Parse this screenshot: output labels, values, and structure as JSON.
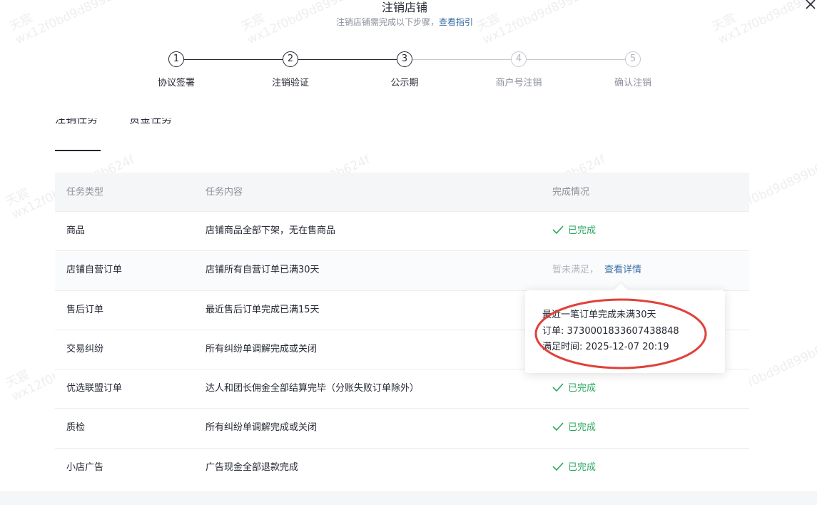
{
  "header": {
    "title": "注销店铺",
    "subtitle": "注销店铺需完成以下步骤，",
    "guide_link": "查看指引"
  },
  "steps": [
    {
      "num": "1",
      "label": "协议签署",
      "state": "done"
    },
    {
      "num": "2",
      "label": "注销验证",
      "state": "done"
    },
    {
      "num": "3",
      "label": "公示期",
      "state": "current"
    },
    {
      "num": "4",
      "label": "商户号注销",
      "state": "pending"
    },
    {
      "num": "5",
      "label": "确认注销",
      "state": "pending"
    }
  ],
  "tabs": [
    {
      "label": "注销任务",
      "active": true
    },
    {
      "label": "资金任务",
      "active": false
    }
  ],
  "table": {
    "headers": [
      "任务类型",
      "任务内容",
      "完成情况"
    ],
    "rows": [
      {
        "type": "商品",
        "content": "店铺商品全部下架，无在售商品",
        "status": "已完成",
        "done": true
      },
      {
        "type": "店铺自营订单",
        "content": "店铺所有自营订单已满30天",
        "status": "暂未满足，",
        "done": false,
        "link": "查看详情"
      },
      {
        "type": "售后订单",
        "content": "最近售后订单完成已满15天",
        "status": "",
        "done": true
      },
      {
        "type": "交易纠纷",
        "content": "所有纠纷单调解完成或关闭",
        "status": "",
        "done": true
      },
      {
        "type": "优选联盟订单",
        "content": "达人和团长佣金全部结算完毕（分账失败订单除外）",
        "status": "已完成",
        "done": true
      },
      {
        "type": "质检",
        "content": "所有纠纷单调解完成或关闭",
        "status": "已完成",
        "done": true
      },
      {
        "type": "小店广告",
        "content": "广告现金全部退款完成",
        "status": "已完成",
        "done": true
      }
    ]
  },
  "popover": {
    "line1": "最近一笔订单完成未满30天",
    "line2": "订单: 3730001833607438848",
    "line3": "满足时间: 2025-12-07 20:19"
  },
  "watermark": {
    "line1": "天宸",
    "line2": "wx12f0bd9d899b624f"
  },
  "colors": {
    "done_green": "#2aa861",
    "link_blue": "#3a6ea5",
    "highlight_red": "#e0413a"
  },
  "icons": {
    "close": "close-icon",
    "check": "check-icon"
  }
}
